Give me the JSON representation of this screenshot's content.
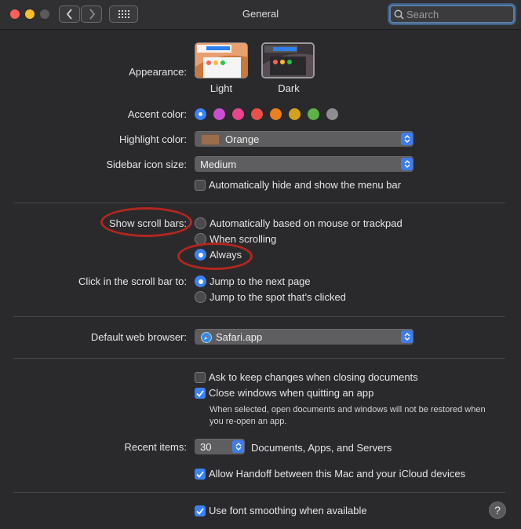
{
  "window": {
    "title": "General",
    "search_placeholder": "Search"
  },
  "appearance": {
    "label": "Appearance:",
    "options": [
      "Light",
      "Dark"
    ],
    "selected": "Dark"
  },
  "accent": {
    "label": "Accent color:",
    "colors": [
      "#3b82f6",
      "#c94fd0",
      "#e9448c",
      "#e9504a",
      "#ec7e22",
      "#d3a11c",
      "#5bb245",
      "#8e8e90"
    ],
    "selected_index": 0
  },
  "highlight": {
    "label": "Highlight color:",
    "value": "Orange",
    "swatch_color": "#9a6d4d"
  },
  "sidebar_icon_size": {
    "label": "Sidebar icon size:",
    "value": "Medium"
  },
  "menu_bar": {
    "label": "Automatically hide and show the menu bar",
    "checked": false
  },
  "scroll_bars": {
    "label": "Show scroll bars:",
    "options": [
      "Automatically based on mouse or trackpad",
      "When scrolling",
      "Always"
    ],
    "selected": "Always"
  },
  "click_scroll": {
    "label": "Click in the scroll bar to:",
    "options": [
      "Jump to the next page",
      "Jump to the spot that’s clicked"
    ],
    "selected": "Jump to the next page"
  },
  "browser": {
    "label": "Default web browser:",
    "value": "Safari.app"
  },
  "documents": {
    "ask_keep_changes": {
      "label": "Ask to keep changes when closing documents",
      "checked": false
    },
    "close_windows": {
      "label": "Close windows when quitting an app",
      "checked": true
    },
    "note": "When selected, open documents and windows will not be restored when you re-open an app."
  },
  "recent": {
    "label": "Recent items:",
    "value": "30",
    "suffix": "Documents, Apps, and Servers"
  },
  "handoff": {
    "label": "Allow Handoff between this Mac and your iCloud devices",
    "checked": true
  },
  "font_smoothing": {
    "label": "Use font smoothing when available",
    "checked": true
  },
  "help": {
    "glyph": "?"
  },
  "annotation_color": "#b3261e"
}
